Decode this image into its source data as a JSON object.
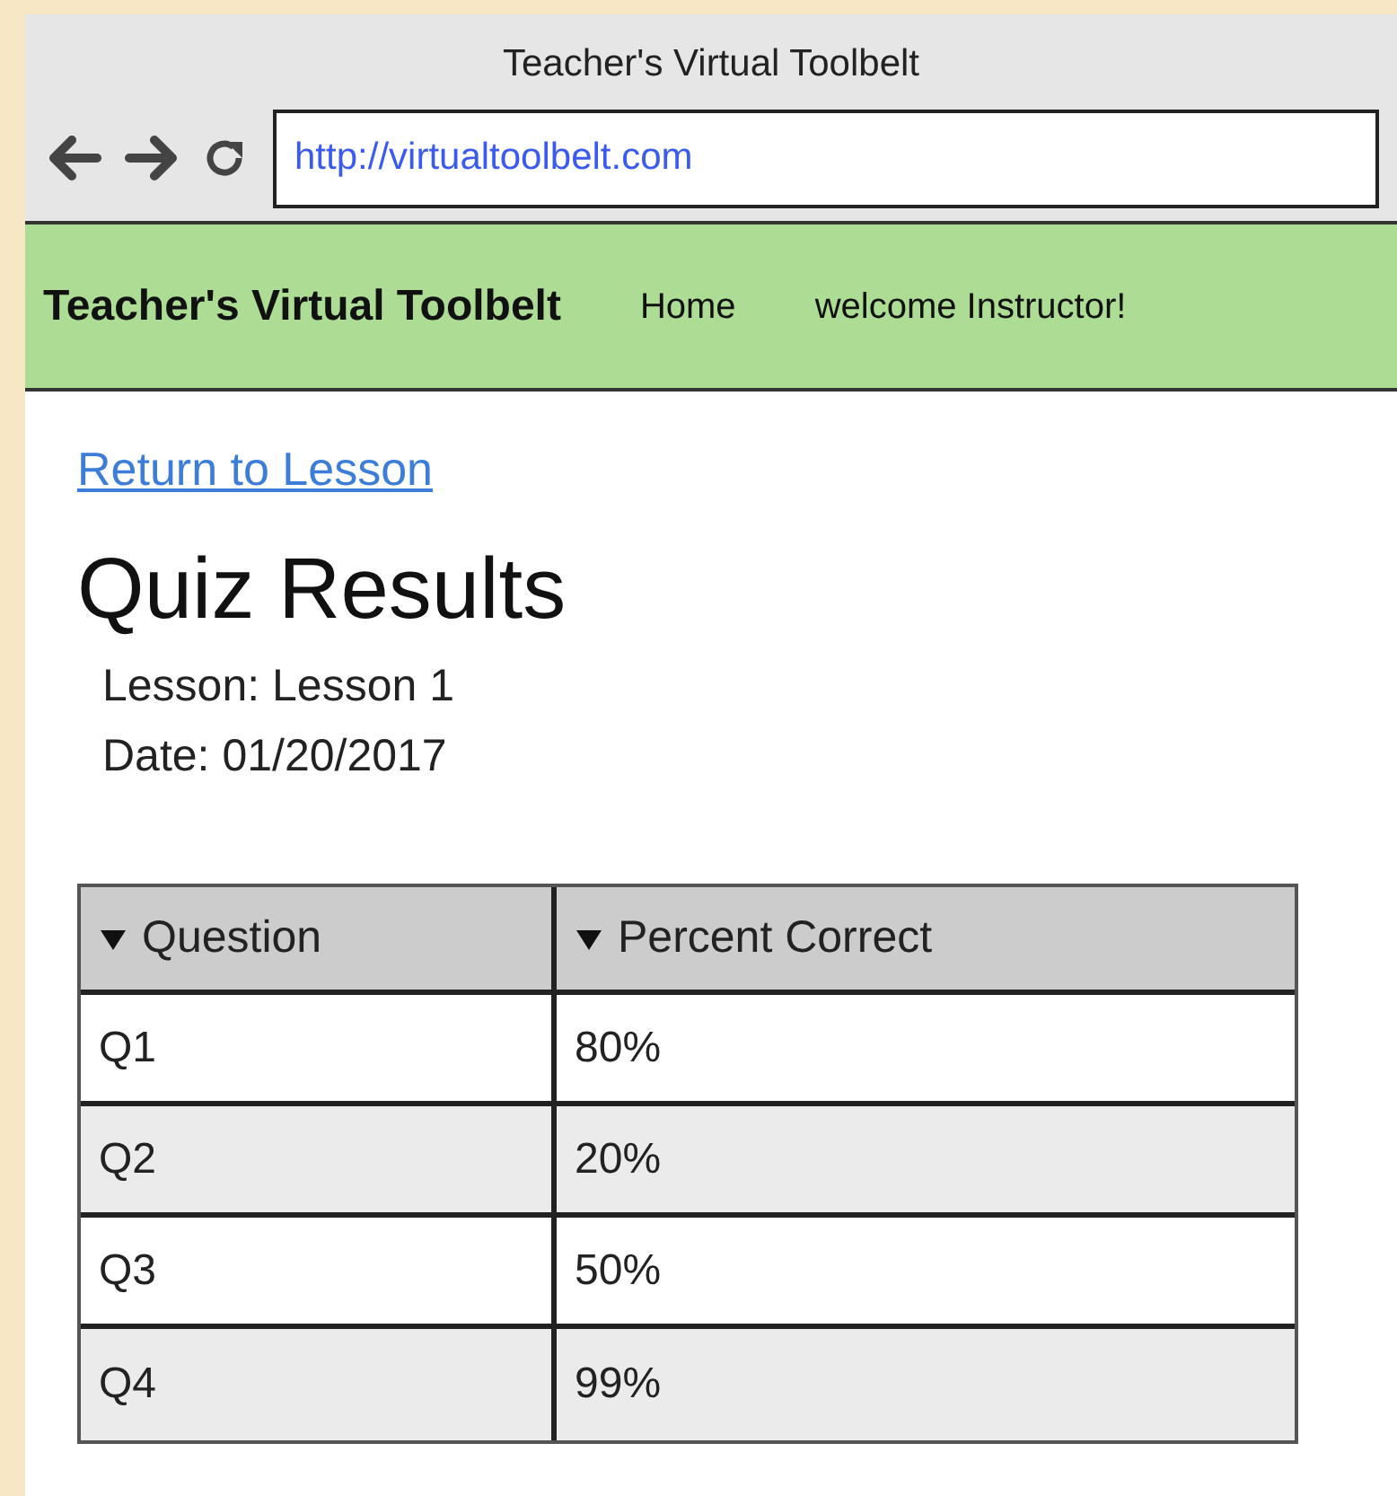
{
  "window": {
    "title": "Teacher's Virtual Toolbelt"
  },
  "address_bar": {
    "value": "http://virtualtoolbelt.com"
  },
  "navbar": {
    "brand": "Teacher's Virtual Toolbelt",
    "links": [
      "Home"
    ],
    "greeting": "welcome Instructor!"
  },
  "back_link": "Return to Lesson",
  "heading": "Quiz Results",
  "details": [
    "Lesson: Lesson 1",
    "Date: 01/20/2017"
  ],
  "table": {
    "columns": [
      "Question",
      "Percent Correct"
    ],
    "rows": [
      [
        "Q1",
        "80%"
      ],
      [
        "Q2",
        "20%"
      ],
      [
        "Q3",
        "50%"
      ],
      [
        "Q4",
        "99%"
      ]
    ]
  }
}
